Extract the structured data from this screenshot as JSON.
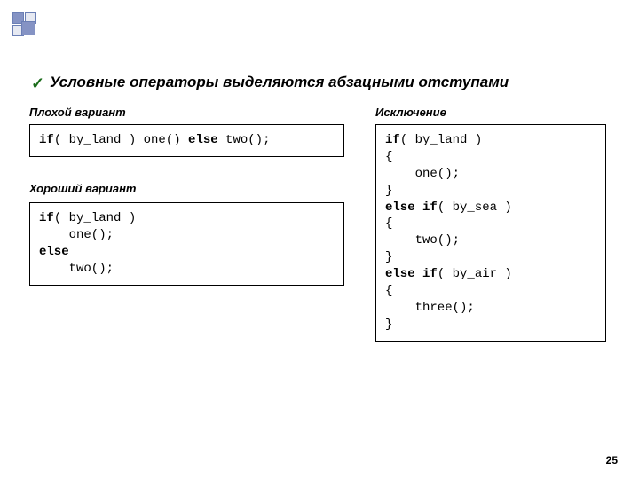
{
  "heading": "Условные операторы выделяются абзацными отступами",
  "labels": {
    "bad": "Плохой вариант",
    "exception": "Исключение",
    "good": "Хороший вариант"
  },
  "code": {
    "bad": {
      "line1a": "if",
      "line1b": "( by_land ) one() ",
      "line1c": "else",
      "line1d": " two();"
    },
    "good": {
      "l1a": "if",
      "l1b": "( by_land )",
      "l2": "    one();",
      "l3": "else",
      "l4": "    two();"
    },
    "exc": {
      "l1a": "if",
      "l1b": "( by_land )",
      "l2": "{",
      "l3": "    one();",
      "l4": "}",
      "l5a": "else if",
      "l5b": "( by_sea )",
      "l6": "{",
      "l7": "    two();",
      "l8": "}",
      "l9a": "else if",
      "l9b": "( by_air )",
      "l10": "{",
      "l11": "    three();",
      "l12": "}"
    }
  },
  "page_number": "25"
}
